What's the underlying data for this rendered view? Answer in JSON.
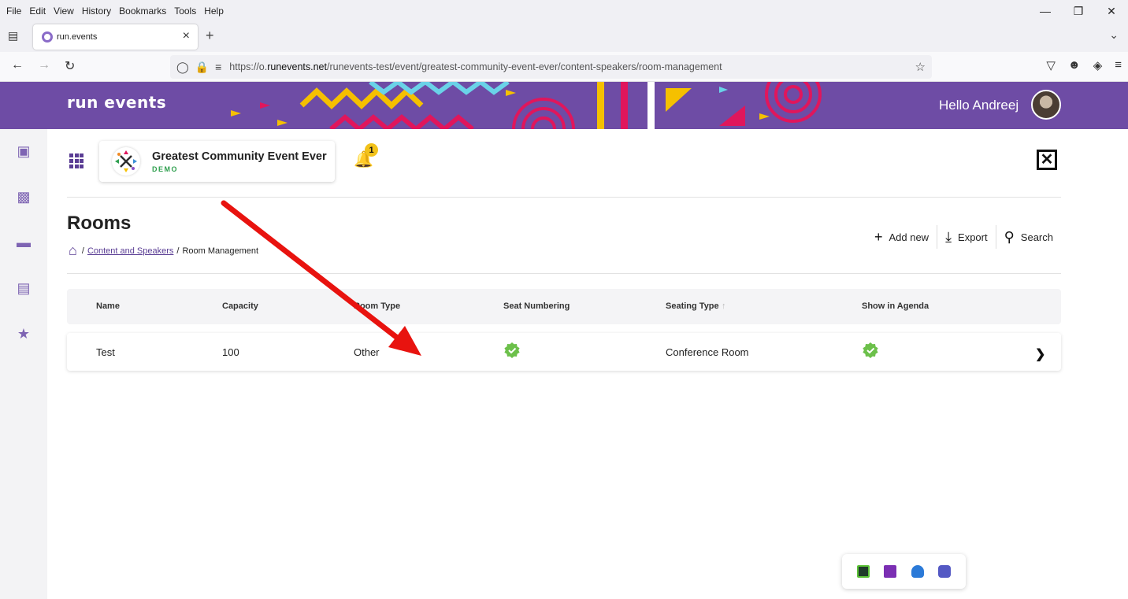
{
  "browser": {
    "menu": [
      "File",
      "Edit",
      "View",
      "History",
      "Bookmarks",
      "Tools",
      "Help"
    ],
    "tab": {
      "title": "run.events"
    },
    "url": {
      "prefix": "https://o.",
      "domain": "runevents.net",
      "path": "/runevents-test/event/greatest-community-event-ever/content-speakers/room-management"
    }
  },
  "header": {
    "logo": "run events",
    "greeting": "Hello Andreej",
    "colors": {
      "banner": "#6e4ca5"
    }
  },
  "sidebar": {
    "icons": [
      "chat-icon",
      "image-icon",
      "folder-icon",
      "clipboard-icon",
      "star-icon"
    ]
  },
  "event": {
    "title": "Greatest Community Event Ever",
    "tag": "DEMO",
    "notifications": "1"
  },
  "page": {
    "title": "Rooms",
    "breadcrumb": {
      "section": "Content and Speakers",
      "current": "Room Management"
    },
    "actions": {
      "add": "Add new",
      "export": "Export",
      "search": "Search"
    }
  },
  "table": {
    "columns": [
      "Name",
      "Capacity",
      "Room Type",
      "Seat Numbering",
      "Seating Type",
      "Show in Agenda"
    ],
    "rows": [
      {
        "name": "Test",
        "capacity": "100",
        "room_type": "Other",
        "seat_numbering": true,
        "seating_type": "Conference Room",
        "show_in_agenda": true
      }
    ]
  },
  "accent": {
    "brand": "#5a3d94",
    "success": "#6cc04a",
    "annotation": "#e8130f"
  }
}
